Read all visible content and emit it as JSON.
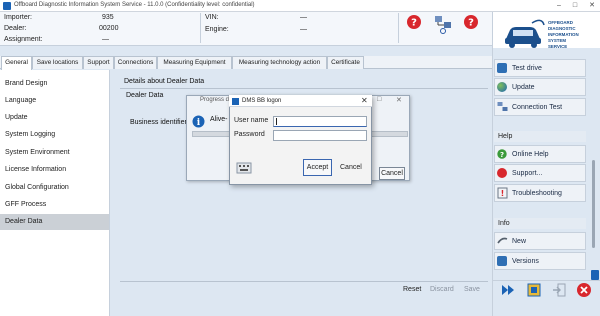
{
  "window": {
    "title": "Offboard Diagnostic Information System Service - 11.0.0 (Confidentiality level: confidential)",
    "controls": [
      "–",
      "□",
      "✕"
    ]
  },
  "header": {
    "importer_label": "Importer:",
    "importer_value": "935",
    "dealer_label": "Dealer:",
    "dealer_value": "00200",
    "assignment_label": "Assignment:",
    "assignment_value": "—",
    "vin_label": "VIN:",
    "vin_value": "—",
    "engine_label": "Engine:",
    "engine_value": "—"
  },
  "logo": {
    "text_lines": [
      "OFFBOARD",
      "DIAGNOSTIC",
      "INFORMATION",
      "SYSTEM",
      "SERVICE"
    ]
  },
  "tabs": [
    "General",
    "Save locations",
    "Support",
    "Connections",
    "Measuring Equipment",
    "Measuring technology action",
    "Certificate"
  ],
  "nav": {
    "items": [
      "Brand Design",
      "Language",
      "Update",
      "System Logging",
      "System Environment",
      "License Information",
      "Global Configuration",
      "GFF Process",
      "Dealer Data"
    ],
    "selected": "Dealer Data"
  },
  "main": {
    "section_title": "Details about Dealer Data",
    "subsection": "Dealer Data",
    "field_label": "Business identifier",
    "buttons": {
      "reset": "Reset",
      "discard": "Discard",
      "save": "Save"
    }
  },
  "progress_dialog": {
    "title": "Progress dis",
    "message": "Alive-",
    "cancel_label": "Cancel"
  },
  "logon_dialog": {
    "title": "DMS BB logon",
    "username_label": "User name",
    "username_value": "",
    "password_label": "Password",
    "password_value": "",
    "accept_label": "Accept",
    "cancel_label": "Cancel"
  },
  "right_panel": {
    "top_buttons": [
      "Test drive",
      "Update",
      "Connection Test"
    ],
    "help_header": "Help",
    "help_buttons": [
      "Online Help",
      "Support...",
      "Troubleshooting"
    ],
    "info_header": "Info",
    "info_buttons": [
      "New",
      "Versions"
    ]
  },
  "colors": {
    "accent": "#1b63b5",
    "background": "#dde7f2",
    "help_icon": "#d8272d"
  }
}
